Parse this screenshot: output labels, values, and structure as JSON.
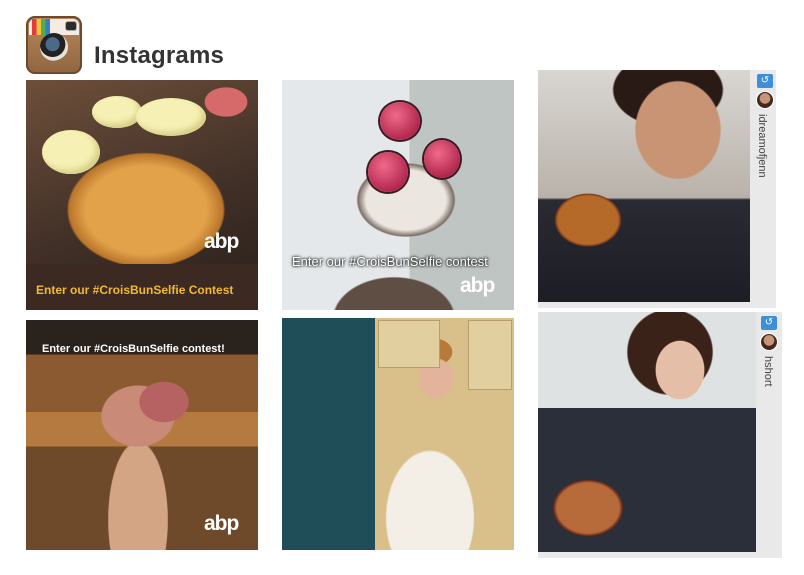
{
  "header": {
    "title": "Instagrams",
    "logo_icon": "instagram-camera-icon"
  },
  "tiles": [
    {
      "banner_text": "Enter our #CroisBunSelfie Contest",
      "watermark": "abp"
    },
    {
      "caption": "Enter our #CroisBunSelfie contest",
      "watermark": "abp"
    },
    {
      "repost_icon": "repost-icon",
      "username": "idreamofjenn"
    },
    {
      "top_text": "Enter our #CroisBunSelfie contest!",
      "watermark": "abp"
    },
    {},
    {
      "repost_icon": "repost-icon",
      "username": "hshort"
    }
  ],
  "colors": {
    "banner_bg": "#3b2922",
    "banner_text": "#f2bb2e",
    "repost_blue": "#3e8ed8",
    "title_text": "#333333"
  }
}
